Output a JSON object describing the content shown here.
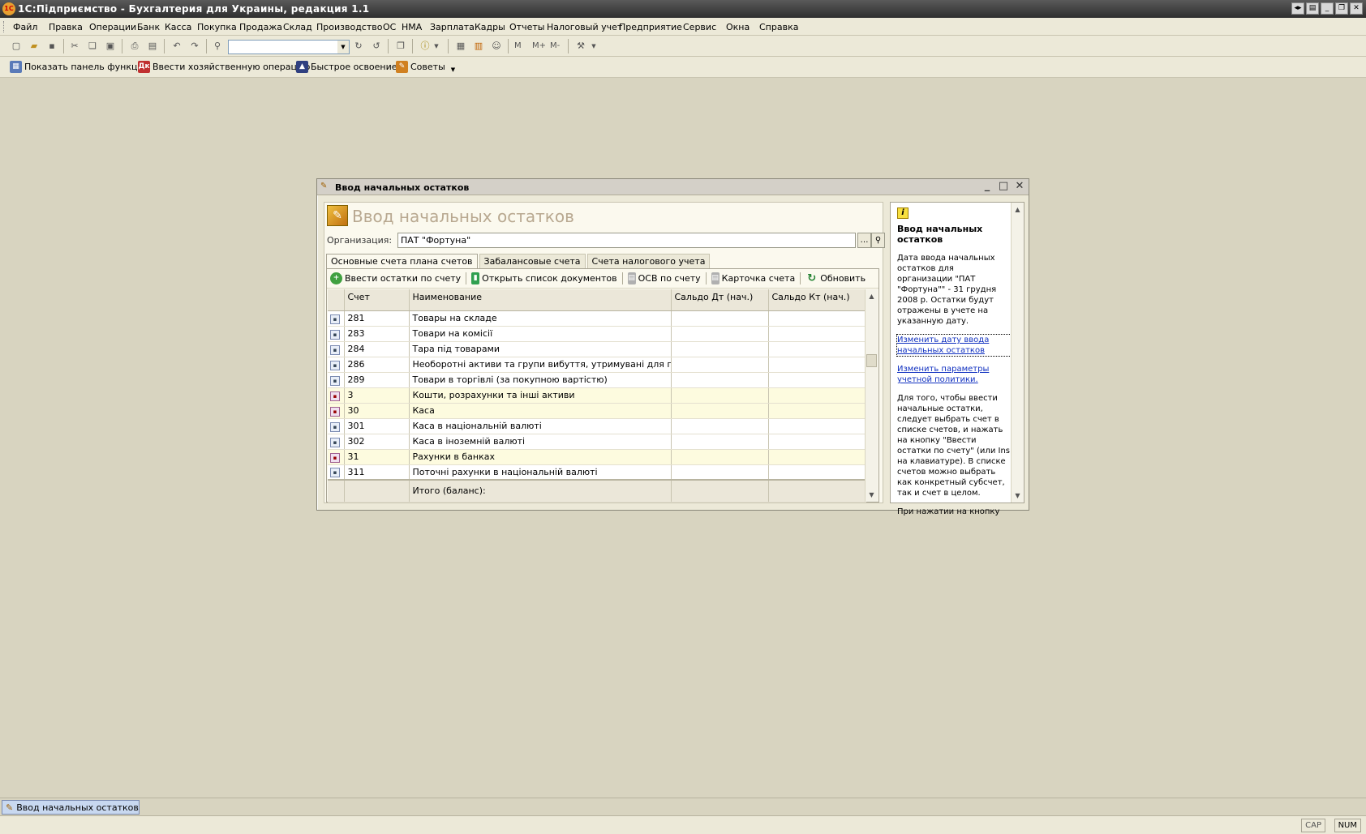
{
  "app": {
    "title": "1С:Підприємство - Бухгалтерия для Украины, редакция 1.1"
  },
  "menu": [
    "Файл",
    "Правка",
    "Операции",
    "Банк",
    "Касса",
    "Покупка",
    "Продажа",
    "Склад",
    "Производство",
    "ОС",
    "НМА",
    "Зарплата",
    "Кадры",
    "Отчеты",
    "Налоговый учет",
    "Предприятие",
    "Сервис",
    "Окна",
    "Справка"
  ],
  "toolbar2": {
    "show_panel": "Показать панель функций",
    "enter_operation": "Ввести хозяйственную операцию",
    "quick_start": "Быстрое освоение",
    "tips": "Советы"
  },
  "window": {
    "title": "Ввод начальных остатков",
    "form_title": "Ввод начальных остатков",
    "org_label": "Организация:",
    "org_value": "ПАТ \"Фортуна\"",
    "tabs": [
      "Основные счета плана счетов",
      "Забалансовые счета",
      "Счета налогового учета"
    ],
    "actions": {
      "enter_balance": "Ввести остатки по счету",
      "open_docs": "Открыть список документов",
      "osv": "ОСВ по счету",
      "account_card": "Карточка счета",
      "refresh": "Обновить"
    },
    "columns": [
      "Счет",
      "Наименование",
      "Сальдо Дт (нач.)",
      "Сальдо Кт (нач.)"
    ],
    "rows": [
      {
        "account": "281",
        "name": "Товары на складе",
        "group": false
      },
      {
        "account": "283",
        "name": "Товари на комісії",
        "group": false
      },
      {
        "account": "284",
        "name": "Тара під товарами",
        "group": false
      },
      {
        "account": "286",
        "name": "Необоротні активи та групи вибуття, утримувані для продажу",
        "group": false
      },
      {
        "account": "289",
        "name": "Товари в торгівлі (за покупною вартістю)",
        "group": false
      },
      {
        "account": "3",
        "name": "Кошти, розрахунки та інші активи",
        "group": true
      },
      {
        "account": "30",
        "name": "Каса",
        "group": true
      },
      {
        "account": "301",
        "name": "Каса в національній валюті",
        "group": false
      },
      {
        "account": "302",
        "name": "Каса в іноземній валюті",
        "group": false
      },
      {
        "account": "31",
        "name": "Рахунки в банках",
        "group": true
      },
      {
        "account": "311",
        "name": "Поточні рахунки в національній валюті",
        "group": false
      }
    ],
    "total_label": "Итого (баланс):"
  },
  "help": {
    "title": "Ввод начальных остатков",
    "p1": "Дата ввода начальных остатков для организации \"ПАТ \"Фортуна\"\" - 31 грудня 2008 р. Остатки будут отражены в учете на указанную дату.",
    "link1": "Изменить дату ввода начальных остатков",
    "link2": "Изменить параметры учетной политики.",
    "p2": "Для того, чтобы ввести начальные остатки, следует выбрать счет в списке счетов, и нажать на кнопку \"Ввести остатки по счету\" (или Ins на клавиатуре). В списке счетов можно выбрать как конкретный субсчет, так и счет в целом.",
    "p3": "При нажатии на кнопку"
  },
  "taskbar": {
    "item": "Ввод начальных остатков"
  },
  "status": {
    "cap": "CAP",
    "num": "NUM"
  }
}
